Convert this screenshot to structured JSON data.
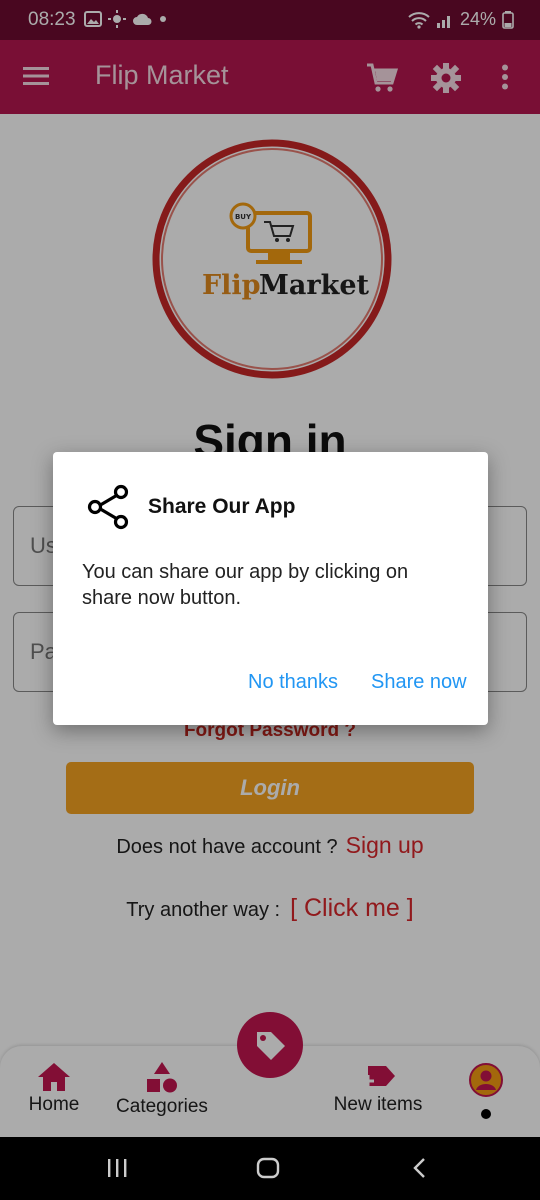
{
  "status_bar": {
    "time": "08:23",
    "battery": "24%"
  },
  "app_bar": {
    "title": "Flip Market"
  },
  "logo": {
    "badge": "BUY",
    "word1": "Flip",
    "word2": "Market"
  },
  "signin": {
    "title": "Sign in",
    "username_placeholder": "Us",
    "password_placeholder": "Pa",
    "forgot": "Forgot Password ?",
    "login": "Login",
    "account_text": "Does not have account ?",
    "signup": "Sign up",
    "try_text": "Try another way :",
    "clickme": "[ Click me ]"
  },
  "bottom_nav": {
    "items": [
      {
        "label": "Home",
        "icon": "home-icon"
      },
      {
        "label": "Categories",
        "icon": "categories-icon"
      },
      {
        "label": "New items",
        "icon": "new-items-icon"
      },
      {
        "label": "",
        "icon": "account-icon"
      }
    ],
    "fab_icon": "tag-icon"
  },
  "dialog": {
    "title": "Share Our App",
    "body": "You can share our app by clicking on share now button.",
    "negative": "No thanks",
    "positive": "Share now"
  },
  "colors": {
    "status_bar": "#6e0b30",
    "app_bar": "#b5174f",
    "accent_red": "#d8262a",
    "login_button": "#f5a321",
    "dialog_button": "#2196f3"
  }
}
